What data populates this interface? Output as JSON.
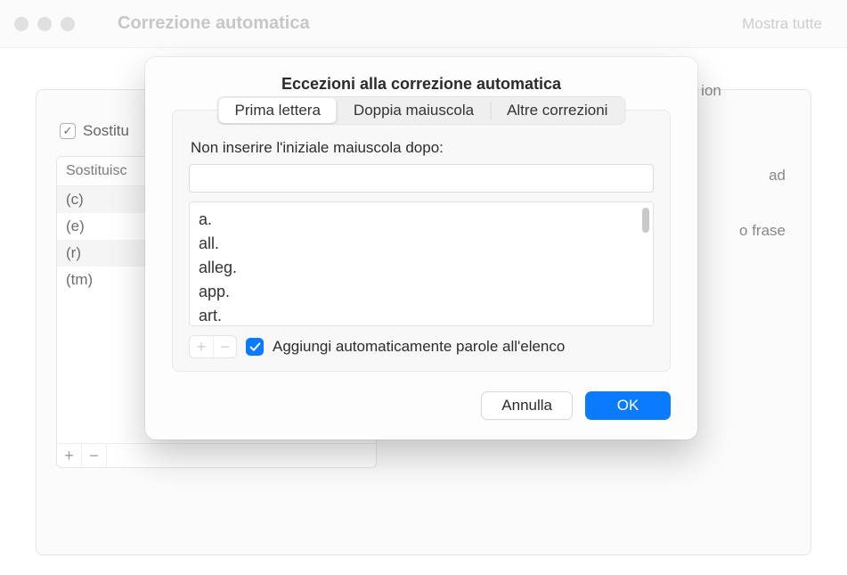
{
  "window": {
    "title": "Correzione automatica",
    "show_all": "Mostra tutte"
  },
  "background": {
    "tab_right": "ion",
    "checkbox_label": "Sostitu",
    "table_header": "Sostituisc",
    "rows": [
      "(c)",
      "(e)",
      "(r)",
      "(tm)"
    ],
    "right_text_1": "ad",
    "right_text_2": "o frase"
  },
  "modal": {
    "title": "Eccezioni alla correzione automatica",
    "tabs": {
      "first_letter": "Prima lettera",
      "double_cap": "Doppia maiuscola",
      "other": "Altre correzioni"
    },
    "instruction": "Non inserire l'iniziale maiuscola dopo:",
    "input_value": "",
    "list_items": [
      "a.",
      "all.",
      "alleg.",
      "app.",
      "art."
    ],
    "auto_add_checkbox": {
      "checked": true,
      "label": "Aggiungi automaticamente parole all'elenco"
    },
    "buttons": {
      "cancel": "Annulla",
      "ok": "OK"
    }
  }
}
